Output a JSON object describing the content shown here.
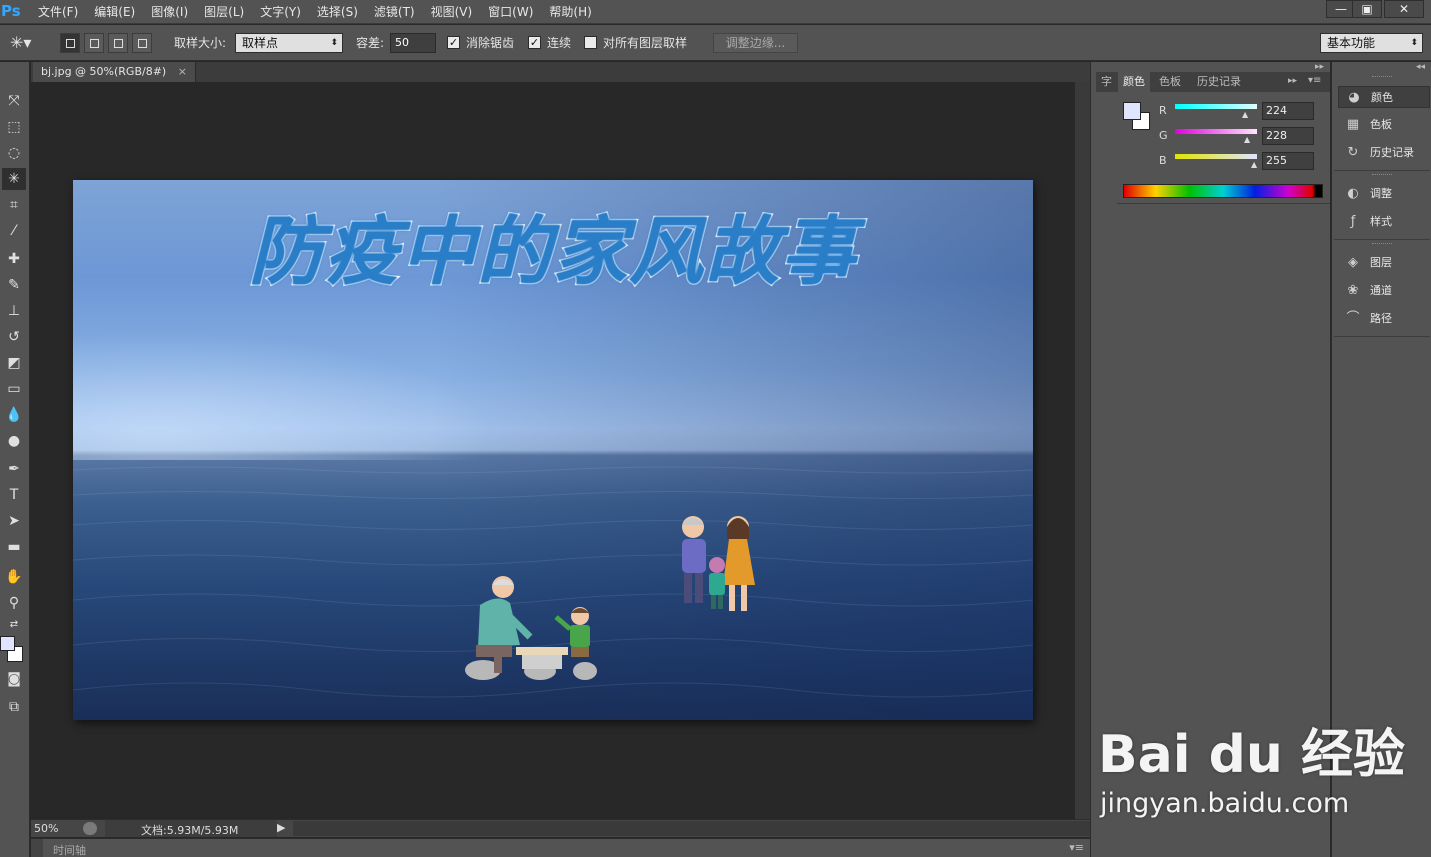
{
  "app": {
    "logo": "Ps"
  },
  "menu": [
    "文件(F)",
    "编辑(E)",
    "图像(I)",
    "图层(L)",
    "文字(Y)",
    "选择(S)",
    "滤镜(T)",
    "视图(V)",
    "窗口(W)",
    "帮助(H)"
  ],
  "window_controls": {
    "minimize": "—",
    "restore": "▣",
    "close": "✕"
  },
  "options": {
    "sample_size_label": "取样大小:",
    "sample_size_value": "取样点",
    "tolerance_label": "容差:",
    "tolerance_value": "50",
    "anti_alias_label": "消除锯齿",
    "anti_alias_checked": true,
    "contiguous_label": "连续",
    "contiguous_checked": true,
    "sample_all_layers_label": "对所有图层取样",
    "sample_all_layers_checked": false,
    "refine_edge_label": "调整边缘...",
    "workspace": "基本功能"
  },
  "document": {
    "tab_label": "bj.jpg @ 50%(RGB/8#)",
    "close_glyph": "×",
    "headline": "防疫中的家风故事"
  },
  "status": {
    "zoom": "50%",
    "doc_info": "文档:5.93M/5.93M",
    "timeline_label": "时间轴"
  },
  "tools": [
    "move-tool-icon",
    "marquee-tool-icon",
    "lasso-tool-icon",
    "magic-wand-tool-icon",
    "crop-tool-icon",
    "eyedropper-tool-icon",
    "healing-brush-icon",
    "brush-tool-icon",
    "clone-stamp-icon",
    "history-brush-icon",
    "eraser-tool-icon",
    "gradient-tool-icon",
    "blur-tool-icon",
    "dodge-tool-icon",
    "pen-tool-icon",
    "type-tool-icon",
    "path-selection-icon",
    "rectangle-tool-icon",
    "hand-tool-icon",
    "zoom-tool-icon"
  ],
  "colors": {
    "foreground": "#e0e4ff",
    "background": "#ffffff"
  },
  "color_panel": {
    "tabs": [
      "字",
      "颜色",
      "色板",
      "历史记录"
    ],
    "channels": [
      {
        "label": "R",
        "value": "224",
        "gradient": "#00ffff"
      },
      {
        "label": "G",
        "value": "228",
        "gradient": "#ff00ff"
      },
      {
        "label": "B",
        "value": "255",
        "gradient": "#e0e400"
      }
    ]
  },
  "dock": {
    "group1": [
      {
        "label": "颜色",
        "icon": "palette-icon"
      },
      {
        "label": "色板",
        "icon": "swatches-icon"
      },
      {
        "label": "历史记录",
        "icon": "history-icon"
      }
    ],
    "group2": [
      {
        "label": "调整",
        "icon": "adjustments-icon"
      },
      {
        "label": "样式",
        "icon": "styles-icon"
      }
    ],
    "group3": [
      {
        "label": "图层",
        "icon": "layers-icon"
      },
      {
        "label": "通道",
        "icon": "channels-icon"
      },
      {
        "label": "路径",
        "icon": "paths-icon"
      }
    ]
  },
  "watermark": {
    "logo": "Bai du 经验",
    "url": "jingyan.baidu.com"
  }
}
